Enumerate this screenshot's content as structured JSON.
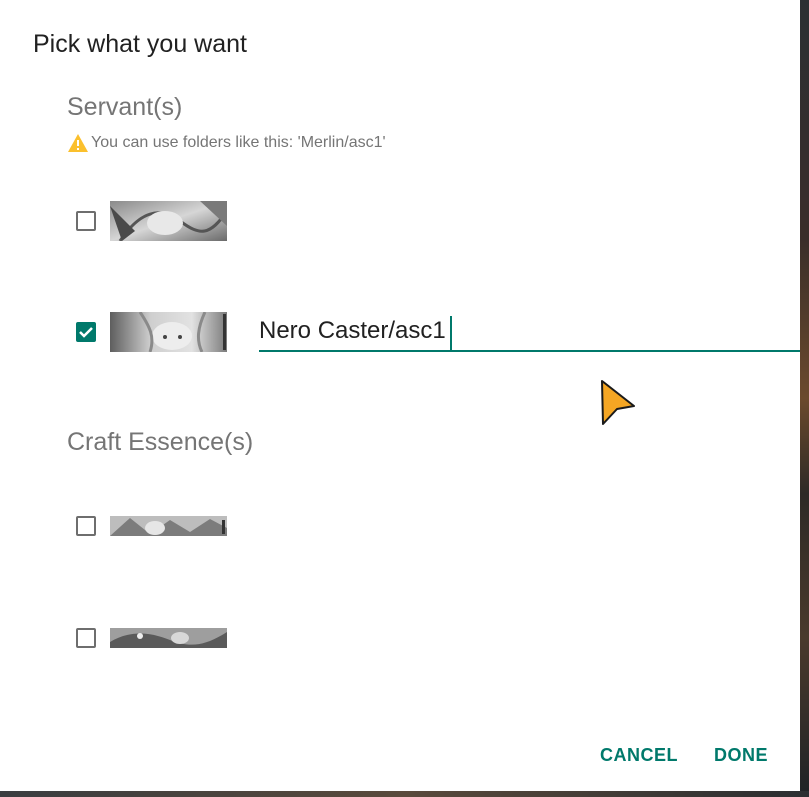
{
  "dialog": {
    "title": "Pick what you want",
    "servants_heading": "Servant(s)",
    "folder_hint": "You can use folders like this: 'Merlin/asc1'",
    "craft_heading": "Craft Essence(s)",
    "servants": [
      {
        "checked": false,
        "thumbnail": "servant-portrait-1"
      },
      {
        "checked": true,
        "thumbnail": "servant-portrait-2",
        "folder_value": "Nero Caster/asc1"
      }
    ],
    "craft_essences": [
      {
        "checked": false,
        "thumbnail": "craft-essence-1"
      },
      {
        "checked": false,
        "thumbnail": "craft-essence-2"
      }
    ],
    "cancel_label": "CANCEL",
    "done_label": "DONE"
  },
  "colors": {
    "accent": "#00796b",
    "warning": "#fbc02d",
    "cursor": "#f5a623"
  }
}
